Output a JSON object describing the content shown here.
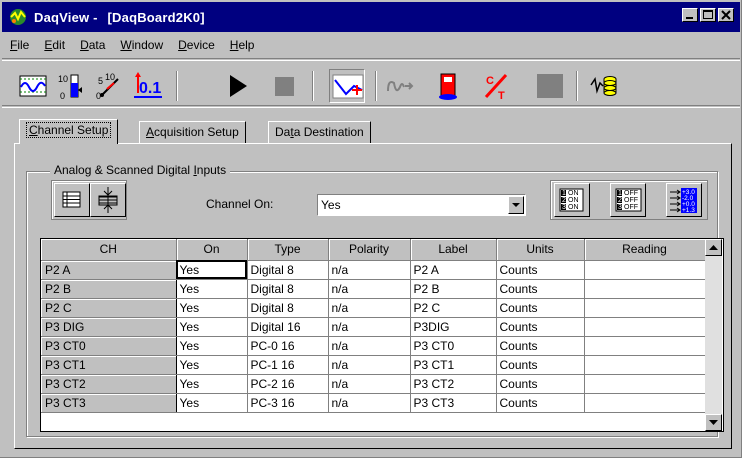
{
  "window": {
    "app_name": "DaqView - ",
    "doc_name": "[DaqBoard2K0]",
    "icon": "daqview-app-icon"
  },
  "menu": [
    {
      "label": "File",
      "u": "F",
      "rest": "ile"
    },
    {
      "label": "Edit",
      "u": "E",
      "rest": "dit"
    },
    {
      "label": "Data",
      "u": "D",
      "rest": "ata"
    },
    {
      "label": "Window",
      "u": "W",
      "rest": "indow"
    },
    {
      "label": "Device",
      "u": "D",
      "rest": "evice"
    },
    {
      "label": "Help",
      "u": "H",
      "rest": "elp"
    }
  ],
  "toolbar": {
    "zero_text": "0.1",
    "icons": [
      "scope-display-icon",
      "bar-graph-icon",
      "analog-meter-icon",
      "digital-meter-icon",
      "play-icon",
      "stop-icon",
      "chart-trend-icon",
      "playback-icon",
      "record-to-disk-icon",
      "calibrate-icon",
      "disabled-button-icon",
      "signal-database-icon"
    ]
  },
  "tabs": [
    {
      "label": "Channel Setup",
      "u": "C",
      "rest": "hannel Setup",
      "active": true
    },
    {
      "label": "Acquisition Setup",
      "u": "A",
      "rest": "cquisition Setup",
      "active": false
    },
    {
      "label": "Data Destination",
      "pre": "Da",
      "u": "t",
      "rest": "a Destination",
      "active": false
    }
  ],
  "group": {
    "title_pre": "Analog & Scanned Digital ",
    "title_u": "I",
    "title_rest": "nputs"
  },
  "channel_on": {
    "label": "Channel On:",
    "value": "Yes"
  },
  "status_glyphs": {
    "on": [
      "1",
      "ON",
      "2",
      "ON",
      "3",
      "ON"
    ],
    "off": [
      "1",
      "OFF",
      "2",
      "OFF",
      "3",
      "OFF"
    ],
    "readings": [
      "+3.0",
      "-2.0",
      "+0.0",
      "+1.3"
    ]
  },
  "grid": {
    "columns": [
      "CH",
      "On",
      "Type",
      "Polarity",
      "Label",
      "Units",
      "Reading"
    ],
    "rows": [
      [
        "P2  A",
        "Yes",
        "Digital 8",
        "n/a",
        "P2  A",
        "Counts",
        ""
      ],
      [
        "P2  B",
        "Yes",
        "Digital 8",
        "n/a",
        "P2  B",
        "Counts",
        ""
      ],
      [
        "P2  C",
        "Yes",
        "Digital 8",
        "n/a",
        "P2  C",
        "Counts",
        ""
      ],
      [
        "P3  DIG",
        "Yes",
        "Digital 16",
        "n/a",
        "P3DIG",
        "Counts",
        ""
      ],
      [
        "P3  CT0",
        "Yes",
        "PC-0 16",
        "n/a",
        "P3 CT0",
        "Counts",
        ""
      ],
      [
        "P3  CT1",
        "Yes",
        "PC-1 16",
        "n/a",
        "P3 CT1",
        "Counts",
        ""
      ],
      [
        "P3  CT2",
        "Yes",
        "PC-2 16",
        "n/a",
        "P3 CT2",
        "Counts",
        ""
      ],
      [
        "P3  CT3",
        "Yes",
        "PC-3 16",
        "n/a",
        "P3 CT3",
        "Counts",
        ""
      ]
    ]
  },
  "colors": {
    "title_bar": "#000080",
    "face": "#c0c0c0",
    "accent_red": "#ff0000",
    "accent_blue": "#0000ff",
    "accent_yellow": "#ffff00"
  }
}
